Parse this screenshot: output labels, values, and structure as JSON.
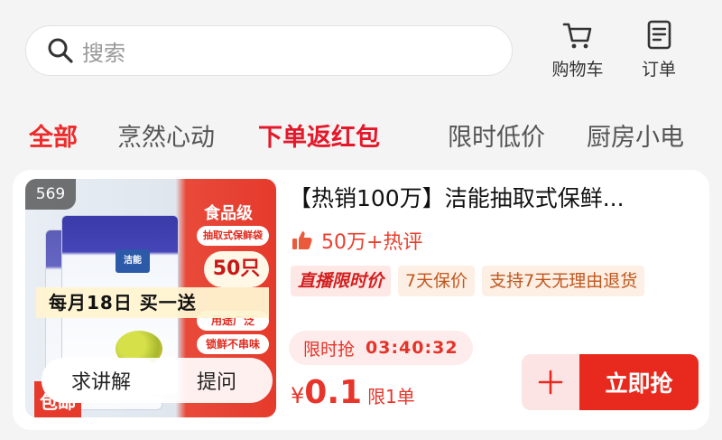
{
  "search": {
    "placeholder": "搜索"
  },
  "top_actions": {
    "cart_label": "购物车",
    "orders_label": "订单"
  },
  "tabs": [
    {
      "label": "全部",
      "active": true
    },
    {
      "label": "烹然心动"
    },
    {
      "label": "下单返红包",
      "promo": true
    },
    {
      "label": "限时低价"
    },
    {
      "label": "厨房小电"
    }
  ],
  "product": {
    "index_badge": "569",
    "title": "【热销100万】洁能抽取式保鲜...",
    "reviews": "50万+热评",
    "tags": [
      "直播限时价",
      "7天保价",
      "支持7天无理由退货"
    ],
    "flash_label": "限时抢",
    "countdown": "03:40:32",
    "currency": "¥",
    "price": "0.1",
    "limit": "限1单",
    "buy_label": "立即抢",
    "image": {
      "brand": "洁能",
      "food_grade": "食品级",
      "type": "抽取式保鲜袋",
      "count": "50只",
      "promo_banner": "每月18日 买一送",
      "feature_1": "用途广泛",
      "feature_2": "锁鲜不串味",
      "corner_badge": "包邮",
      "explain_label": "求讲解",
      "question_label": "提问"
    }
  },
  "colors": {
    "accent": "#e8291d",
    "promo_text": "#e4182a",
    "tag_bg": "#fdefe4"
  }
}
